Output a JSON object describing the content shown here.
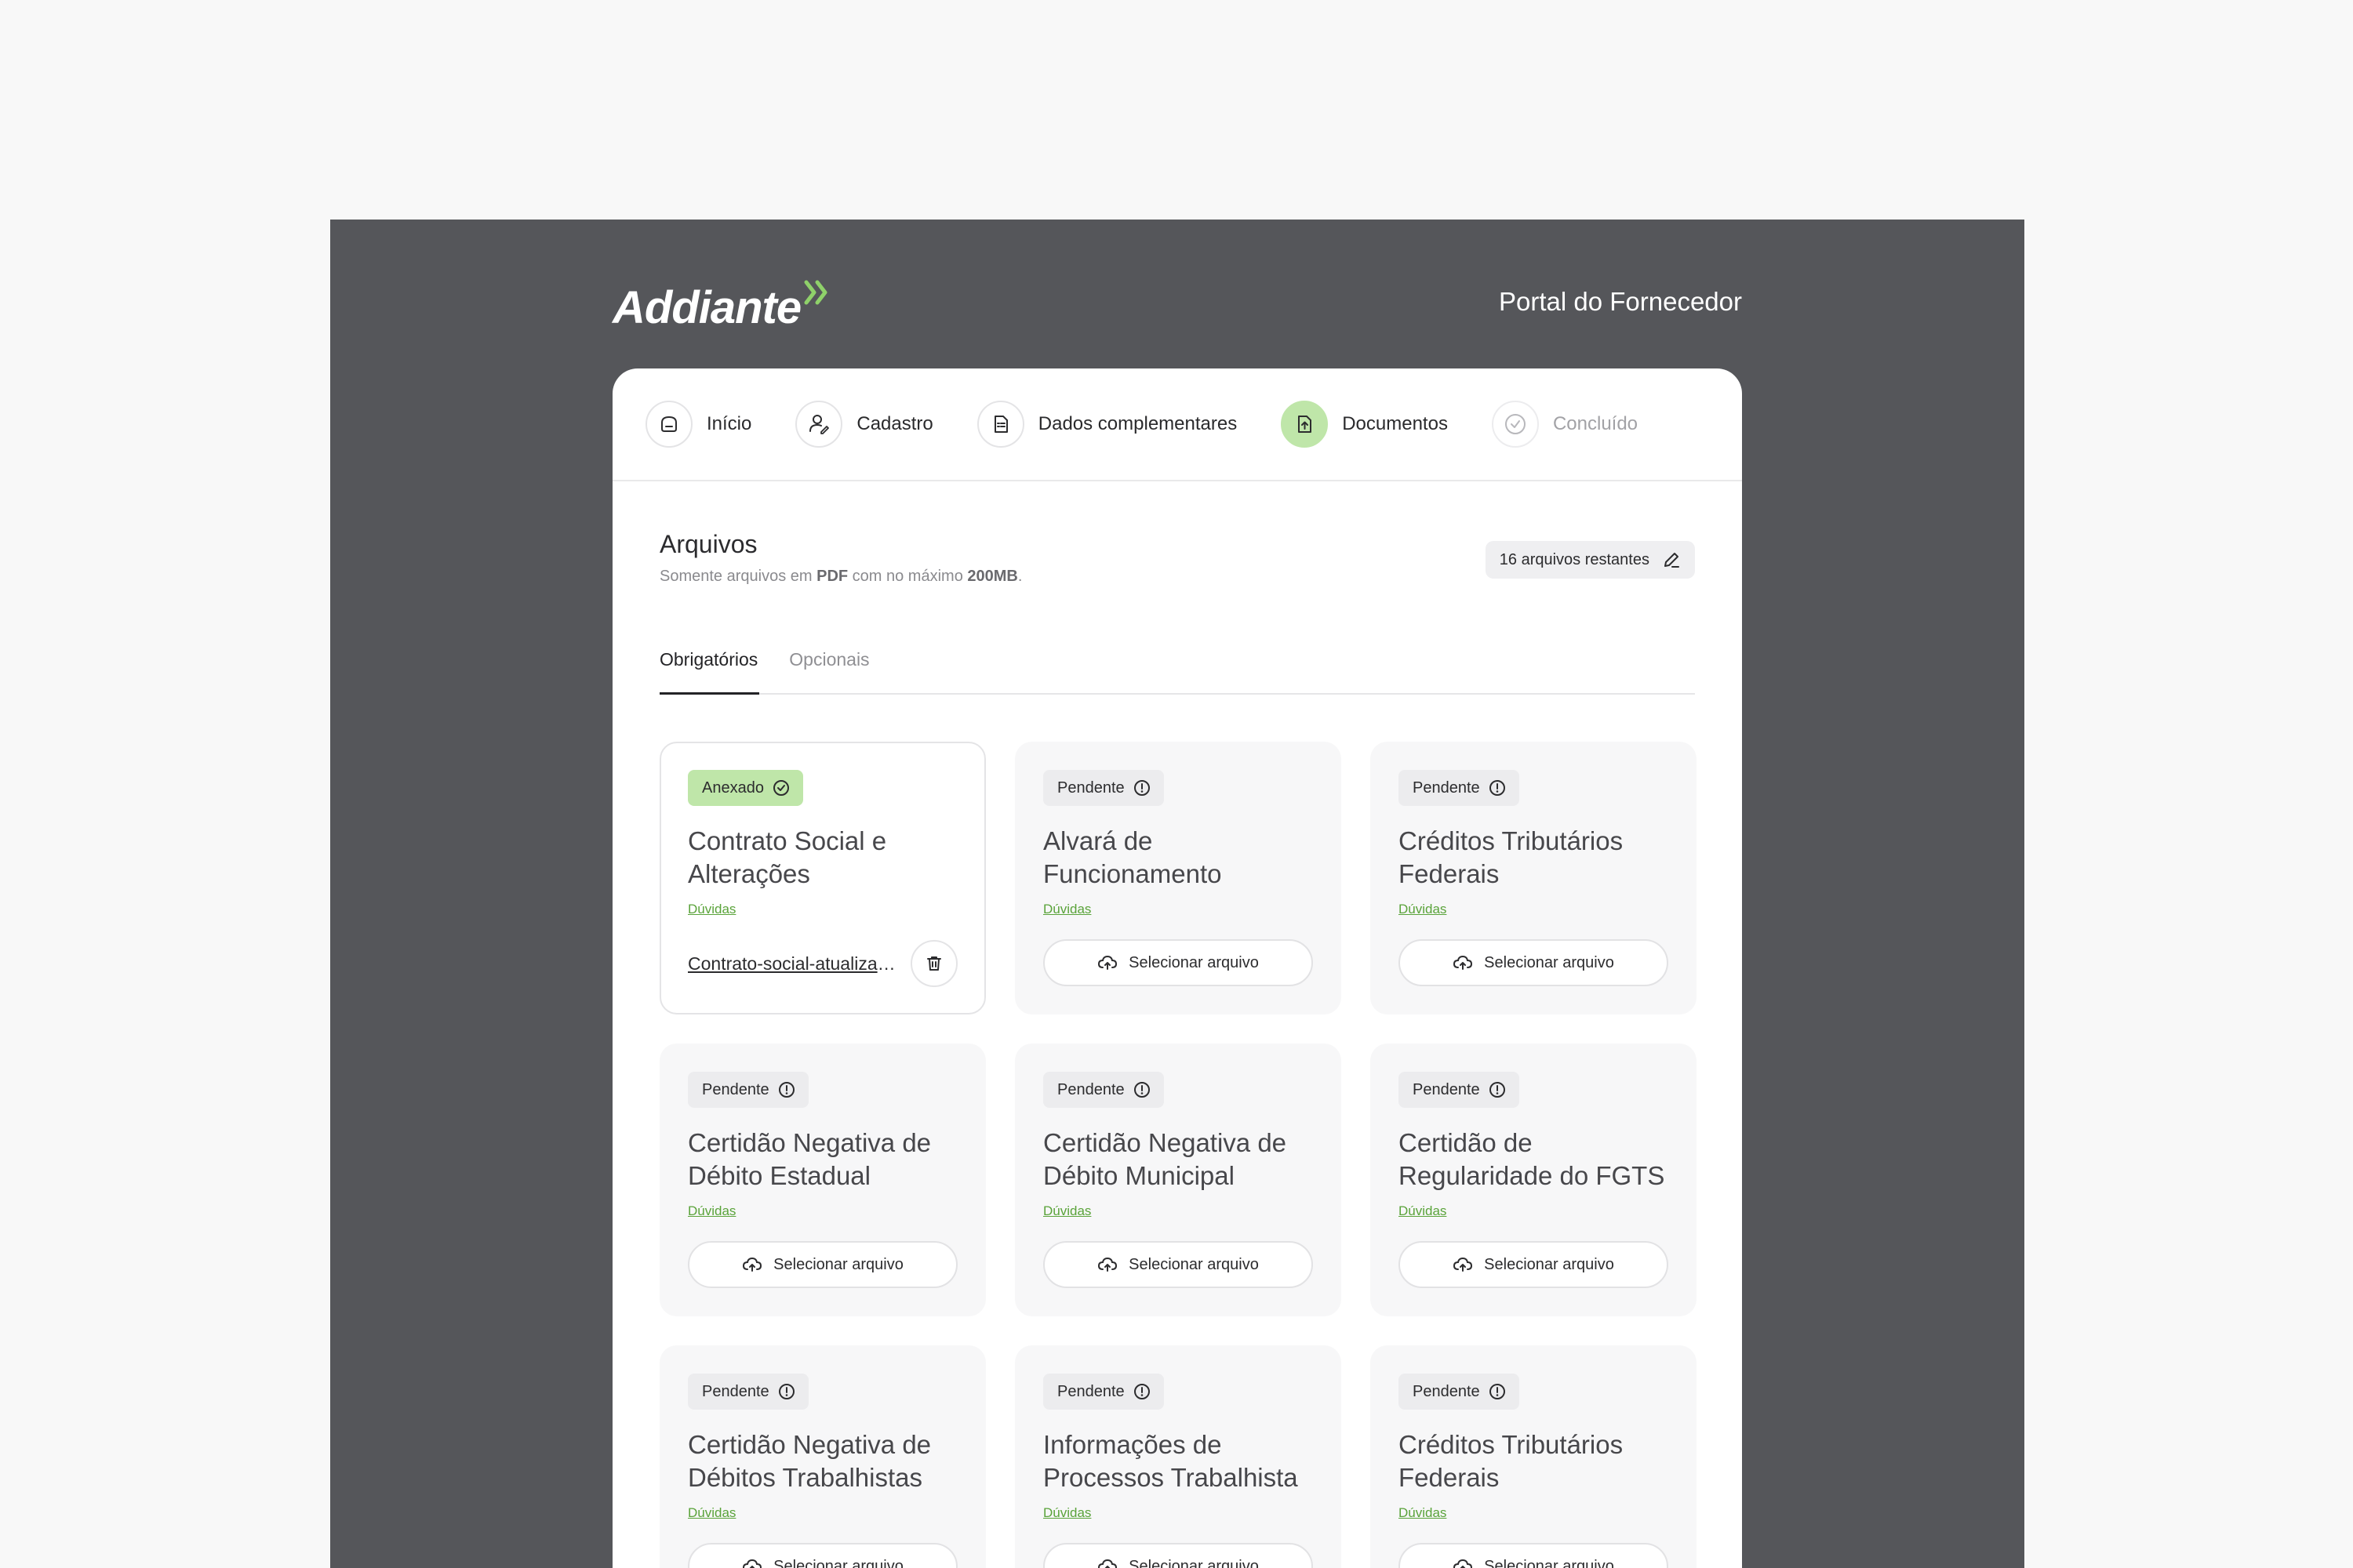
{
  "brand": {
    "name": "Addiante",
    "portal_title": "Portal do Fornecedor",
    "accent": "#8fd16a"
  },
  "steps": [
    {
      "label": "Início",
      "icon": "home-icon",
      "state": "default"
    },
    {
      "label": "Cadastro",
      "icon": "user-edit-icon",
      "state": "default"
    },
    {
      "label": "Dados complementares",
      "icon": "document-list-icon",
      "state": "default"
    },
    {
      "label": "Documentos",
      "icon": "file-upload-icon",
      "state": "active"
    },
    {
      "label": "Concluído",
      "icon": "check-circle-icon",
      "state": "muted"
    }
  ],
  "files": {
    "title": "Arquivos",
    "subtitle_pre": "Somente arquivos em ",
    "subtitle_b1": "PDF",
    "subtitle_mid": " com no máximo ",
    "subtitle_b2": "200MB",
    "subtitle_post": ".",
    "remaining": "16 arquivos restantes"
  },
  "tabs": [
    {
      "label": "Obrigatórios",
      "active": true
    },
    {
      "label": "Opcionais",
      "active": false
    }
  ],
  "documents": [
    {
      "status": "Anexado",
      "title": "Contrato Social e Alterações",
      "help": "Dúvidas",
      "file": "Contrato-social-atualizado.pdf"
    },
    {
      "status": "Pendente",
      "title": "Alvará de Funcionamento",
      "help": "Dúvidas",
      "action": "Selecionar arquivo"
    },
    {
      "status": "Pendente",
      "title": "Créditos Tributários Federais",
      "help": "Dúvidas",
      "action": "Selecionar arquivo"
    },
    {
      "status": "Pendente",
      "title": "Certidão Negativa de Débito Estadual",
      "help": "Dúvidas",
      "action": "Selecionar arquivo"
    },
    {
      "status": "Pendente",
      "title": "Certidão Negativa de Débito Municipal",
      "help": "Dúvidas",
      "action": "Selecionar arquivo"
    },
    {
      "status": "Pendente",
      "title": "Certidão de Regularidade do FGTS",
      "help": "Dúvidas",
      "action": "Selecionar arquivo"
    },
    {
      "status": "Pendente",
      "title": "Certidão Negativa de Débitos Trabalhistas",
      "help": "Dúvidas",
      "action": "Selecionar arquivo"
    },
    {
      "status": "Pendente",
      "title": "Informações de Processos Trabalhista",
      "help": "Dúvidas",
      "action": "Selecionar arquivo"
    },
    {
      "status": "Pendente",
      "title": "Créditos Tributários Federais",
      "help": "Dúvidas",
      "action": "Selecionar arquivo"
    }
  ]
}
